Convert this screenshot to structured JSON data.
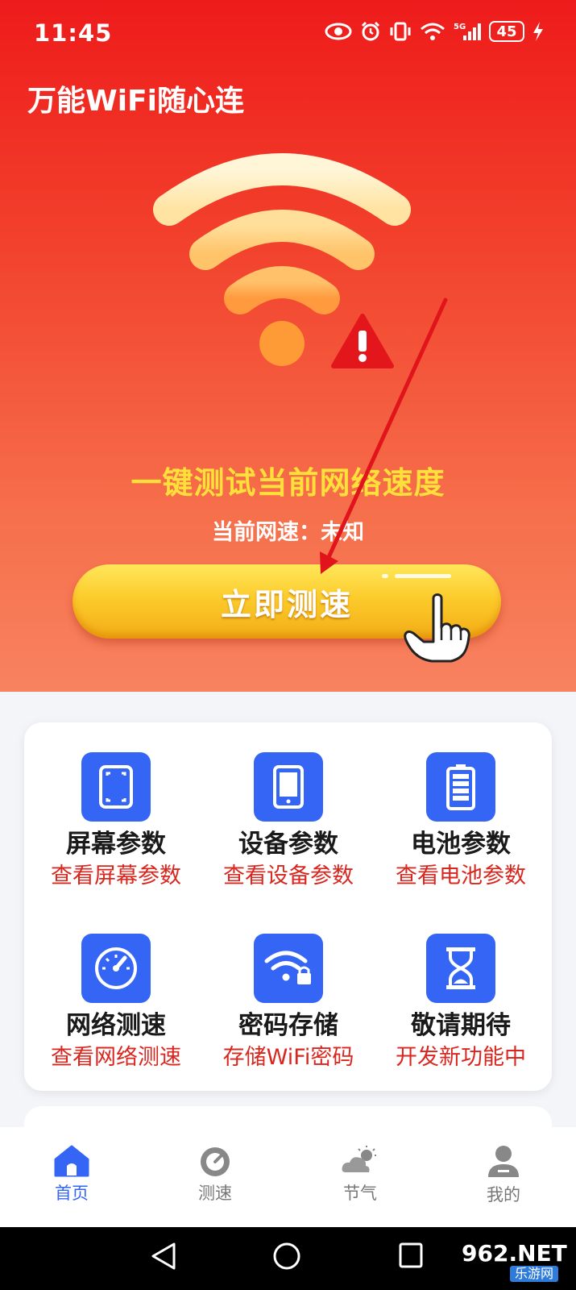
{
  "status_bar": {
    "time": "11:45",
    "network_label": "5G",
    "battery_level": "45",
    "icons": [
      "eye-icon",
      "alarm-icon",
      "vibrate-icon",
      "wifi-icon",
      "signal-icon",
      "battery-icon",
      "charging-icon"
    ]
  },
  "app": {
    "title": "万能WiFi随心连"
  },
  "hero": {
    "headline": "一键测试当前网络速度",
    "speed_label": "当前网速：未知",
    "test_button_label": "立即测速",
    "graphic_icons": [
      "wifi-signal-icon",
      "warning-icon",
      "pointing-hand-icon"
    ]
  },
  "features": [
    {
      "title": "屏幕参数",
      "subtitle": "查看屏幕参数",
      "icon": "screen-icon"
    },
    {
      "title": "设备参数",
      "subtitle": "查看设备参数",
      "icon": "device-icon"
    },
    {
      "title": "电池参数",
      "subtitle": "查看电池参数",
      "icon": "battery-icon"
    },
    {
      "title": "网络测速",
      "subtitle": "查看网络测速",
      "icon": "speedometer-icon"
    },
    {
      "title": "密码存储",
      "subtitle": "存储WiFi密码",
      "icon": "wifi-lock-icon"
    },
    {
      "title": "敬请期待",
      "subtitle": "开发新功能中",
      "icon": "hourglass-icon"
    }
  ],
  "bottom_nav": [
    {
      "label": "首页",
      "icon": "home-icon",
      "active": true
    },
    {
      "label": "测速",
      "icon": "speedometer-icon",
      "active": false
    },
    {
      "label": "节气",
      "icon": "weather-icon",
      "active": false
    },
    {
      "label": "我的",
      "icon": "person-icon",
      "active": false
    }
  ],
  "watermark": {
    "top": "962.NET",
    "bottom": "乐游网"
  },
  "colors": {
    "hero_top": "#ee1b1b",
    "hero_bottom": "#f88260",
    "headline": "#ffdf3a",
    "button": "#fccb2c",
    "feature_icon_bg": "#3565f5",
    "feature_subtitle": "#d9271f",
    "nav_active": "#3565f5"
  }
}
